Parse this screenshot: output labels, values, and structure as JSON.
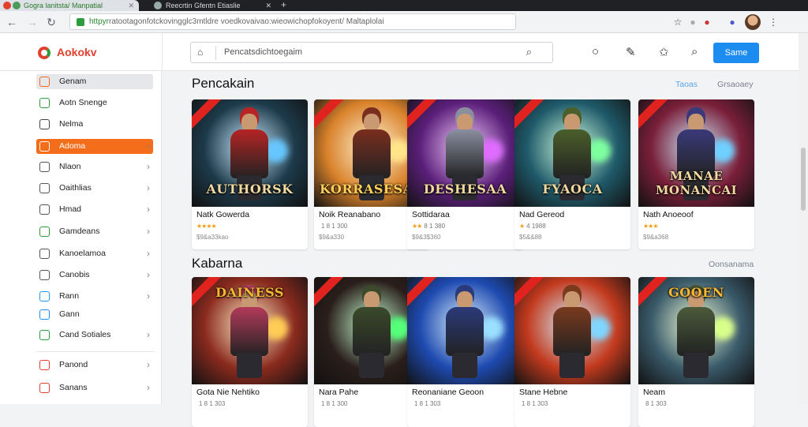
{
  "browser": {
    "active_tab_title": "Gogra lanitsta/ Manpatial",
    "inactive_tab_title": "Reecrtin Gfentn Etiaslie",
    "url_scheme": "httpyr",
    "url_rest": "ratootagonfotckovingglc3mtldre voedkovaivao:wieowichopfokoyent/ Maltaplolai"
  },
  "app": {
    "brand": "Aokokv",
    "search_placeholder": "Pencatsdichtoegaim",
    "cta_label": "Same",
    "sidebar": [
      {
        "label": "Genam",
        "icon": "store-icon",
        "color": "#f36d1b",
        "state": "gray",
        "chevron": false
      },
      {
        "label": "Aotn Snenge",
        "icon": "shield-icon",
        "color": "#2e9b3c",
        "state": "",
        "chevron": false
      },
      {
        "label": "Nelma",
        "icon": "chart-icon",
        "color": "#444444",
        "state": "",
        "chevron": false
      },
      {
        "label": "Adoma",
        "icon": "grid-icon",
        "color": "#ffffff",
        "state": "active",
        "chevron": true
      },
      {
        "label": "Nlaon",
        "icon": "square-icon",
        "color": "#555555",
        "state": "",
        "chevron": true
      },
      {
        "label": "Oaithlias",
        "icon": "checkbox-icon",
        "color": "#555555",
        "state": "",
        "chevron": true
      },
      {
        "label": "Hmad",
        "icon": "square-icon",
        "color": "#555555",
        "state": "",
        "chevron": true
      },
      {
        "label": "Gamdeans",
        "icon": "cart-icon",
        "color": "#2e9b3c",
        "state": "",
        "chevron": true
      },
      {
        "label": "Kanoelamoa",
        "icon": "book-icon",
        "color": "#555555",
        "state": "",
        "chevron": true
      },
      {
        "label": "Canobis",
        "icon": "globe-icon",
        "color": "#555555",
        "state": "",
        "chevron": true
      },
      {
        "label": "Rann",
        "icon": "twitter-icon",
        "color": "#1d9bf0",
        "state": "",
        "chevron": true
      },
      {
        "label": "Gann",
        "icon": "card-icon",
        "color": "#1d8cf0",
        "state": "",
        "chevron": false
      },
      {
        "label": "Cand Sotiales",
        "icon": "share-icon",
        "color": "#2e9b3c",
        "state": "",
        "chevron": true
      },
      {
        "label": "Panond",
        "icon": "circle-icon",
        "color": "#e2402d",
        "state": "",
        "chevron": true
      },
      {
        "label": "Sanans",
        "icon": "flag-icon",
        "color": "#e2402d",
        "state": "",
        "chevron": true
      }
    ],
    "sections": [
      {
        "title": "Pencakain",
        "links": [
          "Taoas",
          "Grsaoaey"
        ],
        "cards": [
          {
            "name": "Natk Gowerda",
            "stars": "★★★★",
            "rating": "",
            "meta": "$9&a33kao",
            "art_title": "AUTHORSK",
            "bg": "#1d3a4a",
            "accent": "#b62424",
            "glow": "#66c7ff"
          },
          {
            "name": "Noik Reanabano",
            "stars": "",
            "rating": "1 8 1 300",
            "meta": "$9&a330",
            "art_title": "KORRASESAO",
            "bg": "#d9822b",
            "accent": "#7a2e1e",
            "glow": "#ffe58a"
          },
          {
            "name": "Sottidaraa",
            "stars": "★★",
            "rating": "8 1 380",
            "meta": "$9&3$360",
            "art_title": "DESHESAA",
            "bg": "#5b1f7a",
            "accent": "#8a8fa0",
            "glow": "#e06bff"
          },
          {
            "name": "Nad Gereod",
            "stars": "★",
            "rating": "4 1988",
            "meta": "$5&&88",
            "art_title": "FYAOCA",
            "bg": "#1f5a6a",
            "accent": "#4a5f2a",
            "glow": "#7dff9e"
          },
          {
            "name": "Nath Anoeoof",
            "stars": "★★★",
            "rating": "",
            "meta": "$9&a368",
            "art_title": "MANAE MONANCAI",
            "bg": "#7a1f3a",
            "accent": "#3a3a7a",
            "glow": "#6fd0ff"
          }
        ]
      },
      {
        "title": "Kabarna",
        "links": [
          "Oonsanama"
        ],
        "cards": [
          {
            "name": "Gota Nie Nehtiko",
            "stars": "",
            "rating": "1 8 1 303",
            "meta": "",
            "art_title": "DAINESS",
            "bg": "#8a2a1e",
            "accent": "#b33a5a",
            "glow": "#ffcc55"
          },
          {
            "name": "Nara Pahe",
            "stars": "",
            "rating": "1 8 1 300",
            "meta": "",
            "art_title": "",
            "bg": "#2a1e1a",
            "accent": "#3a4a2a",
            "glow": "#55ff7a"
          },
          {
            "name": "Reonaniane Geoon",
            "stars": "",
            "rating": "1 8 1 303",
            "meta": "",
            "art_title": "",
            "bg": "#1e4ab0",
            "accent": "#2a3a7a",
            "glow": "#9be0ff"
          },
          {
            "name": "Stane Hebne",
            "stars": "",
            "rating": "1 8 1 303",
            "meta": "",
            "art_title": "",
            "bg": "#c23a1e",
            "accent": "#7a3a1e",
            "glow": "#7fd6ff"
          },
          {
            "name": "Neam",
            "stars": "",
            "rating": "8 1 303",
            "meta": "",
            "art_title": "GOOEN",
            "bg": "#3a5a6a",
            "accent": "#4a5a3a",
            "glow": "#d9ff8a"
          }
        ]
      }
    ]
  }
}
